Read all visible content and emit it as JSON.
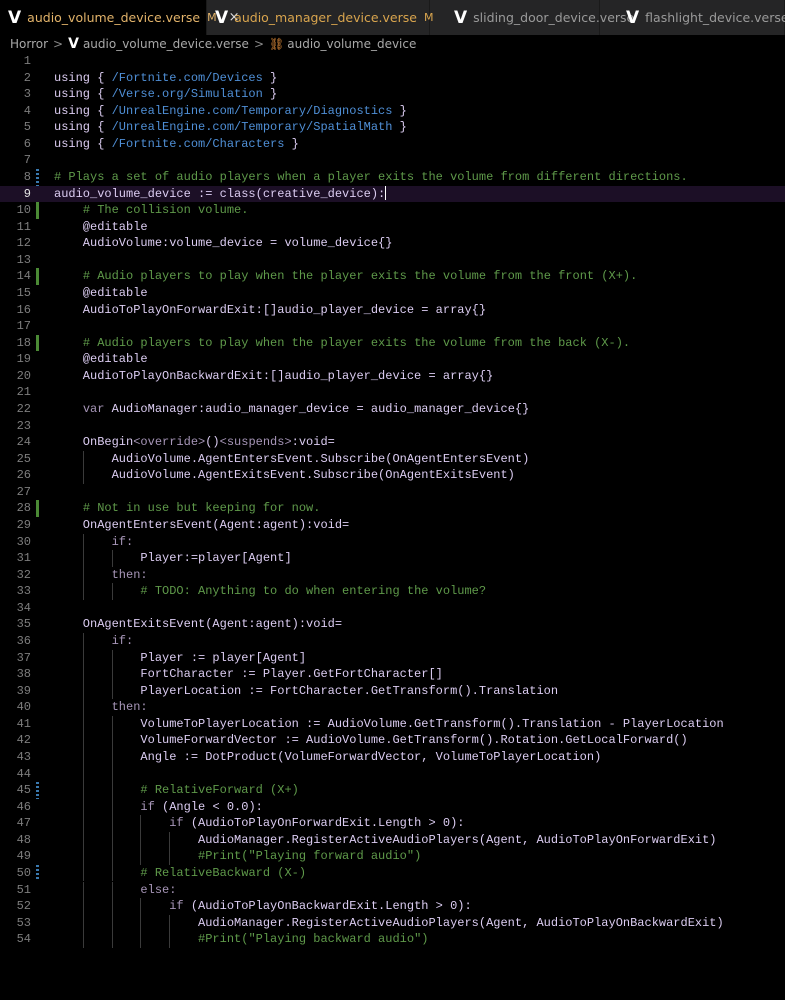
{
  "tabs": [
    {
      "label": "audio_volume_device.verse",
      "flag": "M",
      "active": true
    },
    {
      "label": "audio_manager_device.verse",
      "flag": "M",
      "active": false
    },
    {
      "label": "sliding_door_device.verse",
      "flag": "",
      "active": false
    },
    {
      "label": "flashlight_device.verse",
      "flag": "",
      "active": false
    }
  ],
  "tab_close_icon": "×",
  "logo_glyph": "V",
  "breadcrumb": {
    "folder": "Horror",
    "file": "audio_volume_device.verse",
    "symbol": "audio_volume_device",
    "separator": ">"
  },
  "editor": {
    "cursor_line": 9,
    "added_lines": [
      10,
      14,
      18,
      28
    ],
    "modified_lines": [
      8,
      45,
      50
    ],
    "lines": [
      "",
      "using { /Fortnite.com/Devices }",
      "using { /Verse.org/Simulation }",
      "using { /UnrealEngine.com/Temporary/Diagnostics }",
      "using { /UnrealEngine.com/Temporary/SpatialMath }",
      "using { /Fortnite.com/Characters }",
      "",
      "# Plays a set of audio players when a player exits the volume from different directions.",
      "audio_volume_device := class(creative_device):",
      "    # The collision volume.",
      "    @editable",
      "    AudioVolume:volume_device = volume_device{}",
      "",
      "    # Audio players to play when the player exits the volume from the front (X+).",
      "    @editable",
      "    AudioToPlayOnForwardExit:[]audio_player_device = array{}",
      "",
      "    # Audio players to play when the player exits the volume from the back (X-).",
      "    @editable",
      "    AudioToPlayOnBackwardExit:[]audio_player_device = array{}",
      "",
      "    var AudioManager:audio_manager_device = audio_manager_device{}",
      "",
      "    OnBegin<override>()<suspends>:void=",
      "        AudioVolume.AgentEntersEvent.Subscribe(OnAgentEntersEvent)",
      "        AudioVolume.AgentExitsEvent.Subscribe(OnAgentExitsEvent)",
      "",
      "    # Not in use but keeping for now.",
      "    OnAgentEntersEvent(Agent:agent):void=",
      "        if:",
      "            Player:=player[Agent]",
      "        then:",
      "            # TODO: Anything to do when entering the volume?",
      "",
      "    OnAgentExitsEvent(Agent:agent):void=",
      "        if:",
      "            Player := player[Agent]",
      "            FortCharacter := Player.GetFortCharacter[]",
      "            PlayerLocation := FortCharacter.GetTransform().Translation",
      "        then:",
      "            VolumeToPlayerLocation := AudioVolume.GetTransform().Translation - PlayerLocation",
      "            VolumeForwardVector := AudioVolume.GetTransform().Rotation.GetLocalForward()",
      "            Angle := DotProduct(VolumeForwardVector, VolumeToPlayerLocation)",
      "",
      "            # RelativeForward (X+)",
      "            if (Angle < 0.0):",
      "                if (AudioToPlayOnForwardExit.Length > 0):",
      "                    AudioManager.RegisterActiveAudioPlayers(Agent, AudioToPlayOnForwardExit)",
      "                    #Print(\"Playing forward audio\")",
      "            # RelativeBackward (X-)",
      "            else:",
      "                if (AudioToPlayOnBackwardExit.Length > 0):",
      "                    AudioManager.RegisterActiveAudioPlayers(Agent, AudioToPlayOnBackwardExit)",
      "                    #Print(\"Playing backward audio\")"
    ]
  }
}
